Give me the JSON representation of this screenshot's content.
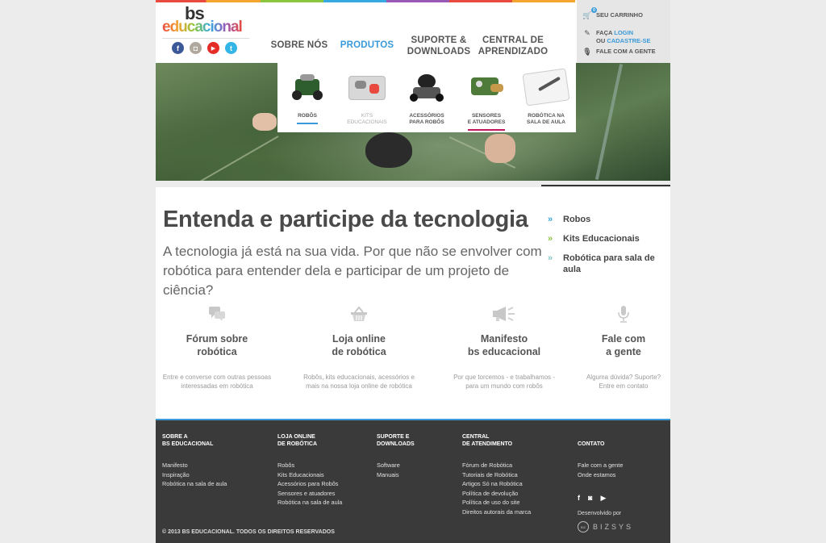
{
  "brand": {
    "logo_top": "bs",
    "logo_bottom": "educacional"
  },
  "socials": [
    {
      "icon": "facebook-icon",
      "glyph": "f",
      "color": "#3b5998"
    },
    {
      "icon": "instagram-icon",
      "glyph": "◘",
      "color": "#b0a89c"
    },
    {
      "icon": "youtube-icon",
      "glyph": "▶",
      "color": "#e52d27"
    },
    {
      "icon": "twitter-icon",
      "glyph": "t",
      "color": "#33b5e5"
    }
  ],
  "nav": {
    "sobre": "SOBRE NÓS",
    "produtos": "PRODUTOS",
    "suporte_1": "SUPORTE &",
    "suporte_2": "DOWNLOADS",
    "central_1": "CENTRAL DE",
    "central_2": "APRENDIZADO"
  },
  "userpanel": {
    "cart_count": "0",
    "cart": "SEU CARRINHO",
    "faca": "FAÇA",
    "login": "LOGIN",
    "ou": "OU",
    "cadastre": "CADASTRE-SE",
    "fale": "FALE COM A GENTE"
  },
  "dropdown": [
    {
      "l1": "ROBÔS",
      "l2": "",
      "muted": false,
      "bar": "#3a9ad9"
    },
    {
      "l1": "KITS",
      "l2": "EDUCACIONAIS",
      "muted": true,
      "bar": "#f3a530"
    },
    {
      "l1": "ACESSÓRIOS",
      "l2": "PARA ROBÔS",
      "muted": false,
      "bar": ""
    },
    {
      "l1": "SENSORES",
      "l2": "E ATUADORES",
      "muted": false,
      "bar": "#c2185b"
    },
    {
      "l1": "ROBÓTICA NA",
      "l2": "SALA DE AULA",
      "muted": false,
      "bar": ""
    }
  ],
  "main": {
    "headline": "Entenda e participe da tecnologia",
    "subhead": "A tecnologia já está na sua vida. Por que não se envolver com robótica para entender dela e participar de um projeto de ciência?"
  },
  "side_links": [
    {
      "label": "Robos",
      "color": "#36a9e1"
    },
    {
      "label": "Kits Educacionais",
      "color": "#8cc63f"
    },
    {
      "label": "Robótica para sala de aula",
      "color": "#7fc6c0"
    }
  ],
  "features": [
    {
      "icon": "chat-bubbles-icon",
      "t1": "Fórum sobre",
      "t2": "robótica",
      "d1": "Entre e converse com outras pessoas",
      "d2": "interessadas em robótica"
    },
    {
      "icon": "shopping-basket-icon",
      "t1": "Loja online",
      "t2": "de robótica",
      "d1": "Robôs, kits educacionais, acessórios e",
      "d2": "mais na nossa loja online de robótica"
    },
    {
      "icon": "megaphone-icon",
      "t1": "Manifesto",
      "t2": "bs educacional",
      "d1": "Por que torcemos - e trabalhamos -",
      "d2": "para um mundo com robôs"
    },
    {
      "icon": "microphone-icon",
      "t1": "Fale com",
      "t2": "a gente",
      "d1": "Alguma dúvida? Suporte?",
      "d2": "Entre em contato"
    }
  ],
  "footer": {
    "cols": [
      {
        "h1": "SOBRE A",
        "h2": "BS EDUCACIONAL",
        "links": [
          "Manifesto",
          "Inspiração",
          "Robótica na sala de aula"
        ]
      },
      {
        "h1": "LOJA ONLINE",
        "h2": "DE ROBÓTICA",
        "links": [
          "Robôs",
          "Kits Educacionais",
          "Acessórios para Robôs",
          "Sensores e atuadores",
          "Robótica na sala de aula"
        ]
      },
      {
        "h1": "SUPORTE E",
        "h2": "DOWNLOADS",
        "links": [
          "Software",
          "Manuais"
        ]
      },
      {
        "h1": "CENTRAL",
        "h2": "DE ATENDIMENTO",
        "links": [
          "Fórum de Robótica",
          "Tutoriais de Robótica",
          "Artigos Só na Robótica",
          "Política de devolução",
          "Política de uso do site",
          "Direitos autorais da marca"
        ]
      }
    ],
    "contato": {
      "h": "CONTATO",
      "links": [
        "Fale com a gente",
        "Onde estamos"
      ]
    },
    "dev_by": "Desenvolvido por",
    "bizsys": "BIZSYS",
    "copyright": "© 2013 BS EDUCACIONAL. TODOS OS DIREITOS RESERVADOS"
  }
}
